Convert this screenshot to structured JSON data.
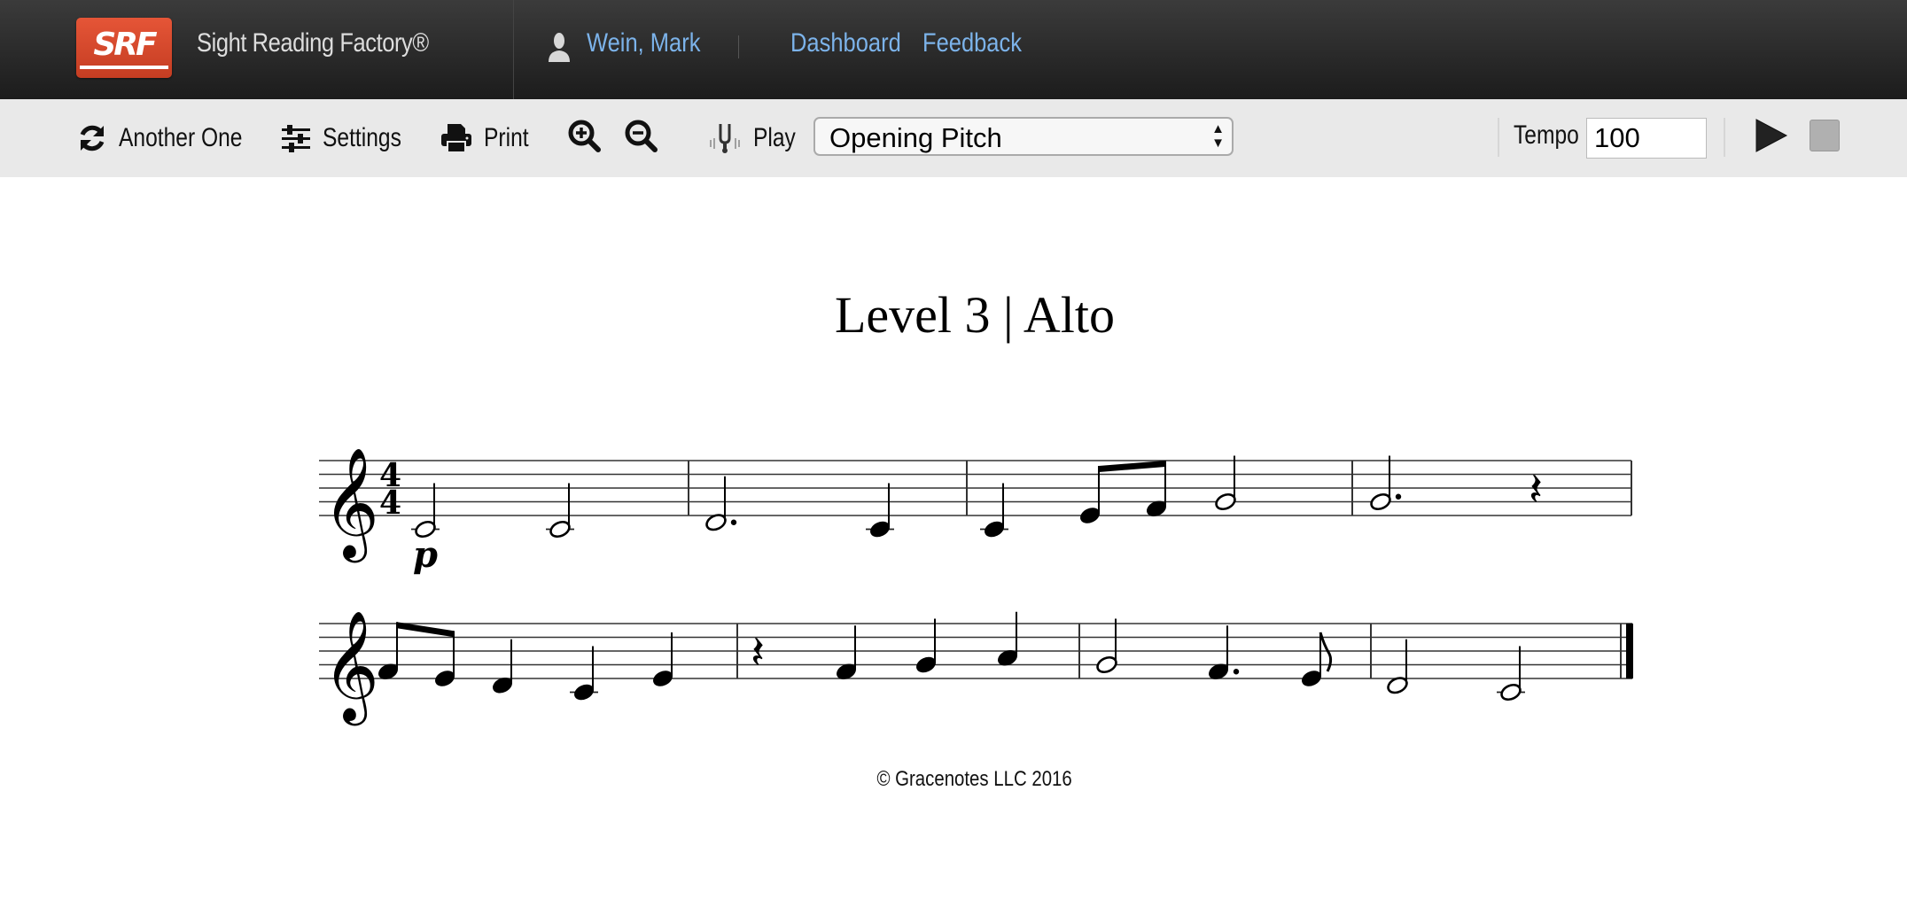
{
  "header": {
    "logo_text": "SRF",
    "brand": "Sight Reading Factory®",
    "user_name": "Wein, Mark",
    "nav": [
      {
        "label": "Dashboard"
      },
      {
        "label": "Feedback"
      }
    ]
  },
  "toolbar": {
    "another_one": "Another One",
    "settings": "Settings",
    "print": "Print",
    "zoom_in_icon": "zoom-in-icon",
    "zoom_out_icon": "zoom-out-icon",
    "play_label": "Play",
    "play_select": {
      "selected": "Opening Pitch"
    },
    "tempo_label": "Tempo",
    "tempo_value": "100"
  },
  "score": {
    "title": "Level 3 | Alto",
    "clef": "treble",
    "time_signature": "4/4",
    "dynamic": "p",
    "systems": [
      {
        "measures": [
          [
            {
              "pitch": "C4",
              "dur": "half"
            },
            {
              "pitch": "C4",
              "dur": "half"
            }
          ],
          [
            {
              "pitch": "D4",
              "dur": "dotted-half"
            },
            {
              "pitch": "C4",
              "dur": "quarter"
            }
          ],
          [
            {
              "pitch": "C4",
              "dur": "quarter"
            },
            {
              "pitch": "E4",
              "dur": "eighth",
              "beam": "start"
            },
            {
              "pitch": "F4",
              "dur": "eighth",
              "beam": "end"
            },
            {
              "pitch": "G4",
              "dur": "half"
            }
          ],
          [
            {
              "pitch": "G4",
              "dur": "dotted-half"
            },
            {
              "rest": true,
              "dur": "quarter"
            }
          ]
        ]
      },
      {
        "measures": [
          [
            {
              "pitch": "F4",
              "dur": "eighth",
              "beam": "start"
            },
            {
              "pitch": "E4",
              "dur": "eighth",
              "beam": "end"
            },
            {
              "pitch": "D4",
              "dur": "quarter"
            },
            {
              "pitch": "C4",
              "dur": "quarter"
            },
            {
              "pitch": "E4",
              "dur": "quarter"
            }
          ],
          [
            {
              "rest": true,
              "dur": "quarter"
            },
            {
              "pitch": "F4",
              "dur": "quarter"
            },
            {
              "pitch": "G4",
              "dur": "quarter"
            },
            {
              "pitch": "A4",
              "dur": "quarter"
            }
          ],
          [
            {
              "pitch": "G4",
              "dur": "half"
            },
            {
              "pitch": "F4",
              "dur": "dotted-quarter"
            },
            {
              "pitch": "E4",
              "dur": "eighth"
            }
          ],
          [
            {
              "pitch": "D4",
              "dur": "half"
            },
            {
              "pitch": "C4",
              "dur": "half"
            }
          ]
        ],
        "final_barline": true
      }
    ]
  },
  "footer": {
    "copyright": "© Gracenotes LLC 2016"
  }
}
